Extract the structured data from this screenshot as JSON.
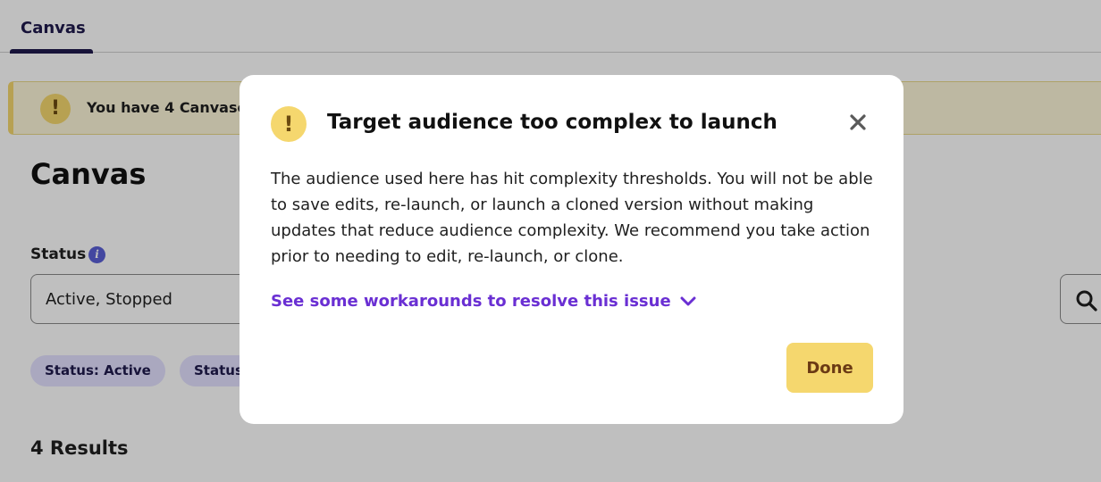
{
  "tabs": [
    {
      "label": "Canvas",
      "active": true
    }
  ],
  "banner": {
    "icon": "!",
    "text": "You have 4 Canvases w"
  },
  "page": {
    "title": "Canvas"
  },
  "filters": {
    "status_label": "Status",
    "info_icon": "i",
    "status_value": "Active, Stopped",
    "chips": [
      "Status: Active",
      "Status"
    ]
  },
  "results_label": "4 Results",
  "modal": {
    "icon": "!",
    "title": "Target audience too complex to launch",
    "body": "The audience used here has hit complexity thresholds. You will not be able to save edits, re-launch, or launch a cloned version without making updates that reduce audience complexity. We recommend you take action prior to needing to edit, re-launch, or clone.",
    "link_text": "See some workarounds to resolve this issue",
    "done_label": "Done"
  },
  "colors": {
    "accent_purple": "#6a2fd3",
    "warning_yellow": "#f5d76e",
    "nav_dark": "#1f1a4d",
    "chip_bg": "#e3e1ff",
    "info_blue": "#5a5fd6"
  },
  "icons": {
    "warning": "exclamation-icon",
    "close": "close-icon",
    "chevron": "chevron-down-icon",
    "search": "search-icon",
    "info": "info-icon"
  }
}
